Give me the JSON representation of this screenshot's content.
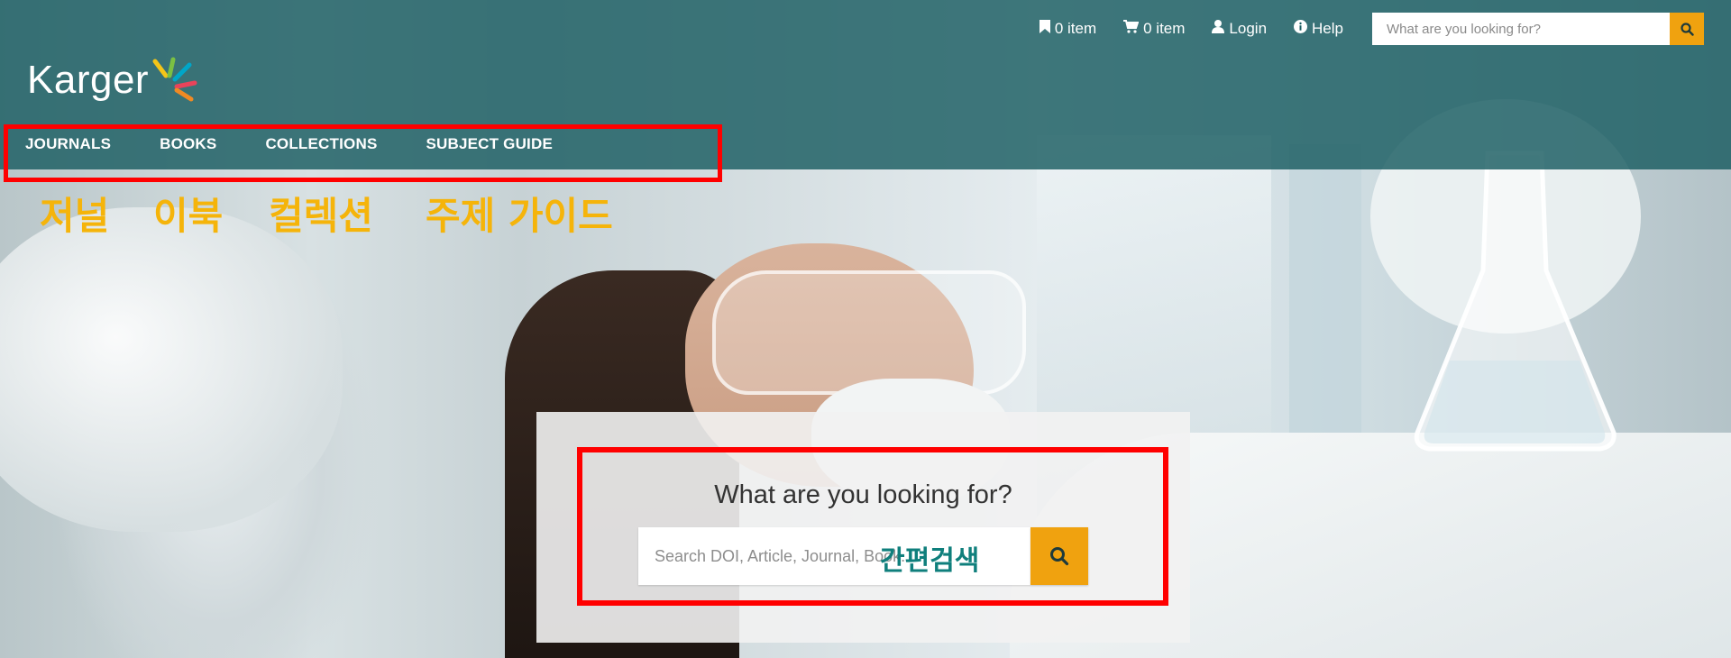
{
  "header": {
    "logo_text": "Karger",
    "utility": {
      "bookmark_label": "0 item",
      "cart_label": "0 item",
      "login_label": "Login",
      "help_label": "Help",
      "search_placeholder": "What are you looking for?"
    },
    "nav": [
      {
        "label": "JOURNALS"
      },
      {
        "label": "BOOKS"
      },
      {
        "label": "COLLECTIONS"
      },
      {
        "label": "SUBJECT GUIDE"
      }
    ]
  },
  "annotations": {
    "nav_translations": [
      "저널",
      "이북",
      "컬렉션",
      "주제 가이드"
    ],
    "search_label": "간편검색",
    "highlight_color": "#ff0000",
    "translation_color": "#f5b40a",
    "search_label_color": "#0f7f7c"
  },
  "main_search": {
    "title": "What are you looking for?",
    "placeholder": "Search DOI, Article, Journal, Book..."
  },
  "colors": {
    "header_bg": "#185c60",
    "accent": "#f0a20f"
  },
  "icons": {
    "bookmark": "bookmark-icon",
    "cart": "cart-icon",
    "login": "user-icon",
    "help": "info-icon",
    "search": "search-icon"
  }
}
